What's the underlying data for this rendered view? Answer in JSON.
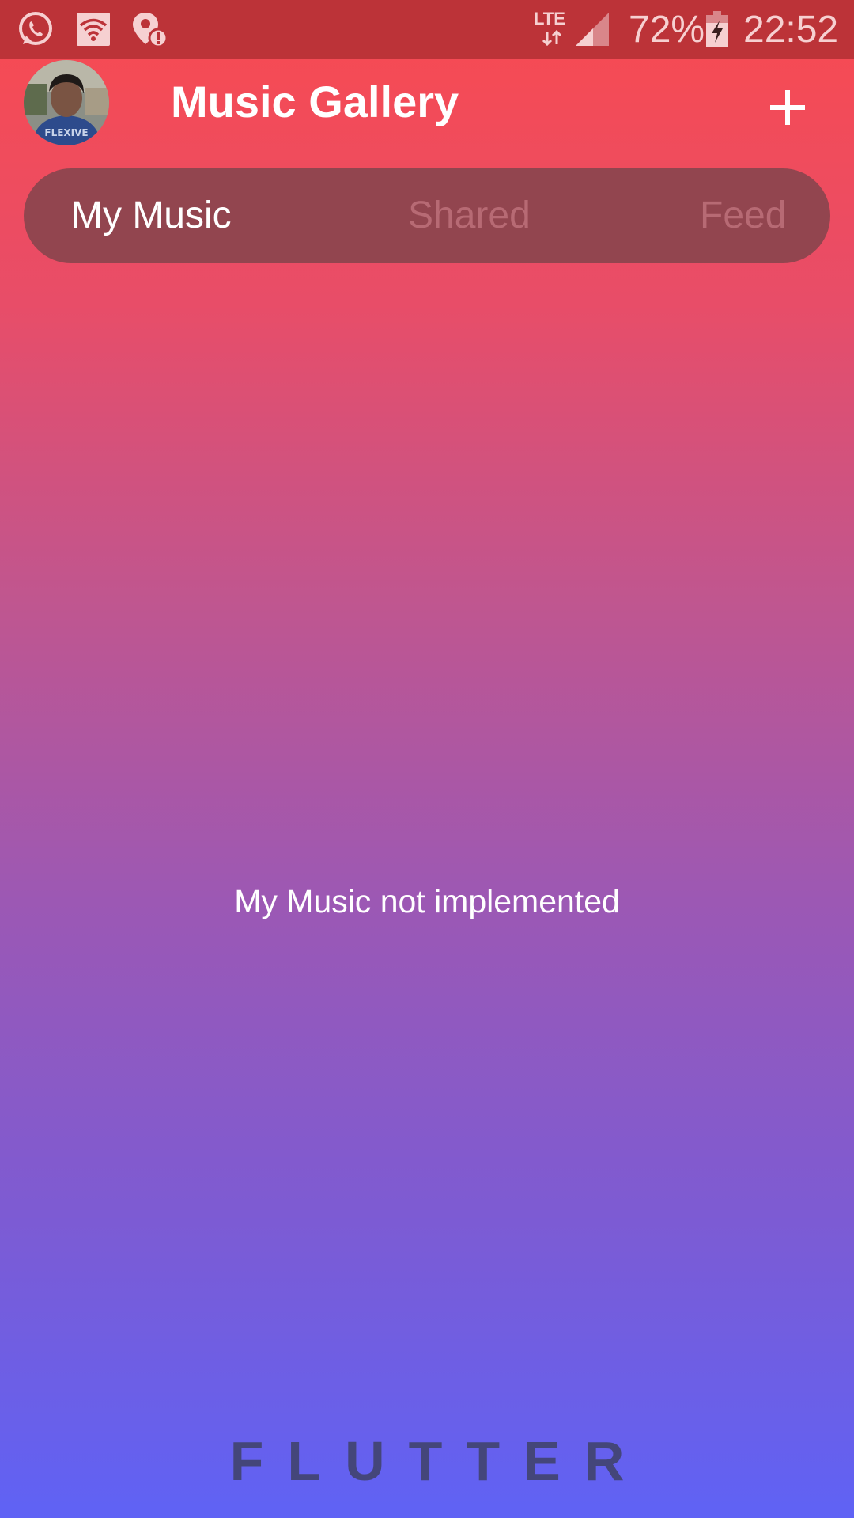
{
  "status_bar": {
    "network_type": "LTE",
    "battery_percent": "72%",
    "time": "22:52",
    "icons": [
      "whatsapp-icon",
      "wifi-icon",
      "location-alert-icon",
      "lte-data-icon",
      "signal-icon",
      "battery-charging-icon"
    ]
  },
  "app_bar": {
    "title": "Music Gallery",
    "avatar_icon": "user-avatar",
    "action_icon": "plus-icon"
  },
  "tabs": [
    {
      "label": "My Music",
      "selected": true
    },
    {
      "label": "Shared",
      "selected": false
    },
    {
      "label": "Feed",
      "selected": false
    }
  ],
  "content": {
    "message": "My Music not implemented"
  },
  "footer": {
    "logo_text": "FLUTTER"
  },
  "colors": {
    "status_bar": "#bc3338",
    "gradient_top": "#f84a50",
    "gradient_bottom": "#5f62f5",
    "tab_bar_bg": "#92454f",
    "tab_inactive": "#b76a74",
    "footer_text": "#44467a"
  }
}
